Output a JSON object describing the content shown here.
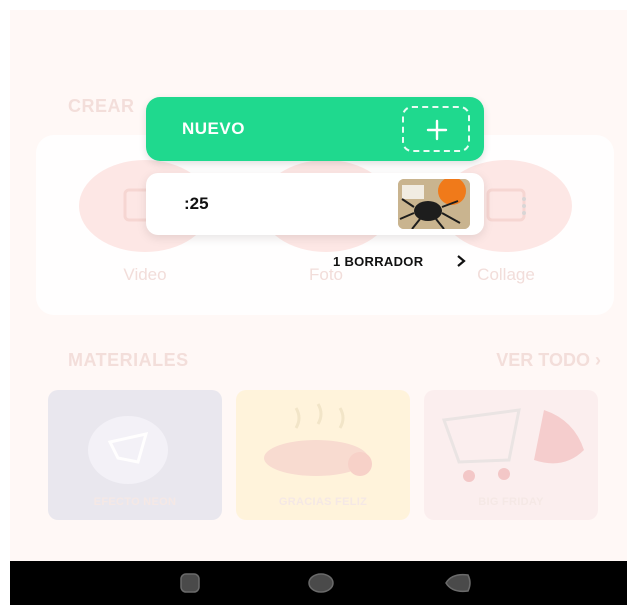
{
  "background": {
    "crear_title": "CREAR",
    "create_options": [
      {
        "label": "Video",
        "icon": "video-icon"
      },
      {
        "label": "Foto",
        "icon": "photo-icon"
      },
      {
        "label": "Collage",
        "icon": "collage-icon"
      }
    ],
    "materials_title": "MATERIALES",
    "ver_todo": "VER TODO",
    "materials": [
      {
        "label": "EFECTO NEON"
      },
      {
        "label": "GRACIAS FELIZ"
      },
      {
        "label": "BIG FRIDAY"
      }
    ]
  },
  "popup": {
    "new_label": "NUEVO",
    "draft_duration": ":25",
    "drafts_link": "1 BORRADOR"
  },
  "colors": {
    "accent_green": "#1fd98e",
    "nav_bar": "#000000",
    "faded_pink": "#fde6e4"
  },
  "nav": {
    "buttons": [
      "recent-apps-icon",
      "home-icon",
      "back-icon"
    ]
  }
}
